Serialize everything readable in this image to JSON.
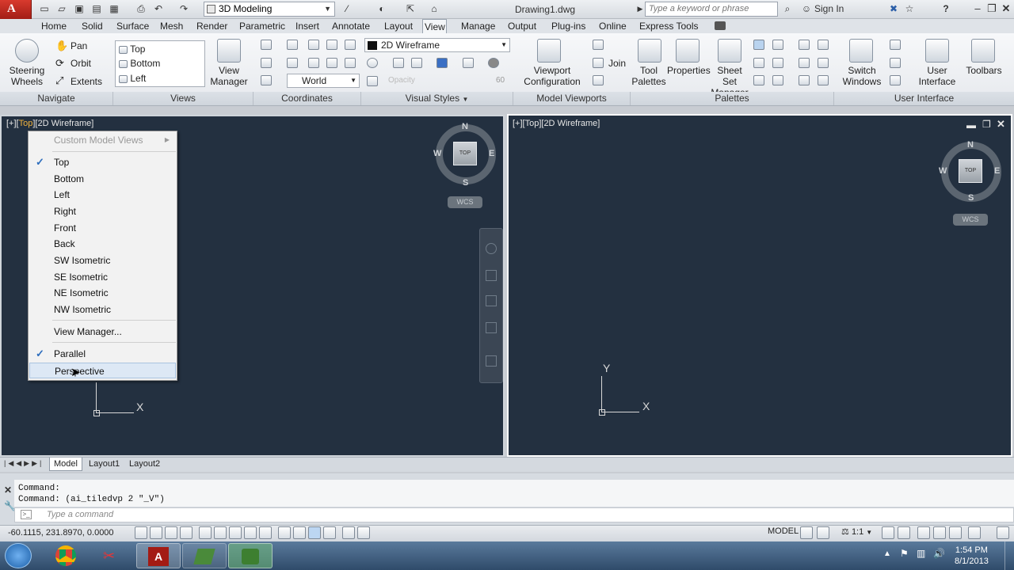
{
  "titlebar": {
    "workspace": "3D Modeling",
    "document": "Drawing1.dwg",
    "search_placeholder": "Type a keyword or phrase",
    "signin": "Sign In"
  },
  "ribbon_tabs": [
    "Home",
    "Solid",
    "Surface",
    "Mesh",
    "Render",
    "Parametric",
    "Insert",
    "Annotate",
    "Layout",
    "View",
    "Manage",
    "Output",
    "Plug-ins",
    "Online",
    "Express Tools"
  ],
  "active_tab": "View",
  "navigate": {
    "steering": "Steering",
    "wheels": "Wheels",
    "pan": "Pan",
    "orbit": "Orbit",
    "extents": "Extents",
    "panel": "Navigate"
  },
  "views": {
    "items": [
      "Top",
      "Bottom",
      "Left"
    ],
    "view_manager_1": "View",
    "view_manager_2": "Manager",
    "panel": "Views"
  },
  "coordinates": {
    "world": "World",
    "panel": "Coordinates"
  },
  "visual_styles": {
    "current": "2D Wireframe",
    "opacity_label": "Opacity",
    "opacity_value": "60",
    "panel": "Visual Styles"
  },
  "model_viewports": {
    "vpconfig_1": "Viewport",
    "vpconfig_2": "Configuration",
    "join": "Join",
    "panel": "Model Viewports"
  },
  "palettes": {
    "tool_1": "Tool",
    "tool_2": "Palettes",
    "properties": "Properties",
    "sheetset_1": "Sheet Set",
    "sheetset_2": "Manager",
    "panel": "Palettes"
  },
  "user_interface": {
    "switch_1": "Switch",
    "switch_2": "Windows",
    "ui_1": "User",
    "ui_2": "Interface",
    "toolbars": "Toolbars",
    "panel": "User Interface"
  },
  "viewport_left": {
    "label_a": "[+][",
    "label_view": "Top",
    "label_b": "][2D Wireframe]"
  },
  "viewport_right": {
    "label": "[+][Top][2D Wireframe]"
  },
  "viewcube": {
    "n": "N",
    "s": "S",
    "e": "E",
    "w": "W",
    "face": "TOP",
    "wcs": "WCS"
  },
  "axis": {
    "y": "Y",
    "x": "X"
  },
  "context_menu": {
    "header": "Custom Model Views",
    "views": [
      "Top",
      "Bottom",
      "Left",
      "Right",
      "Front",
      "Back",
      "SW Isometric",
      "SE Isometric",
      "NE Isometric",
      "NW Isometric"
    ],
    "checked_view": "Top",
    "view_manager": "View Manager...",
    "parallel": "Parallel",
    "perspective": "Perspective"
  },
  "layout_tabs": [
    "Model",
    "Layout1",
    "Layout2"
  ],
  "command": {
    "line1": "Command:",
    "line2": "Command: (ai_tiledvp 2 \"_V\")",
    "placeholder": "Type a command"
  },
  "status": {
    "coords": "-60.1115, 231.8970, 0.0000",
    "model": "MODEL",
    "scale": "1:1"
  },
  "clock": {
    "time": "1:54 PM",
    "date": "8/1/2013"
  }
}
